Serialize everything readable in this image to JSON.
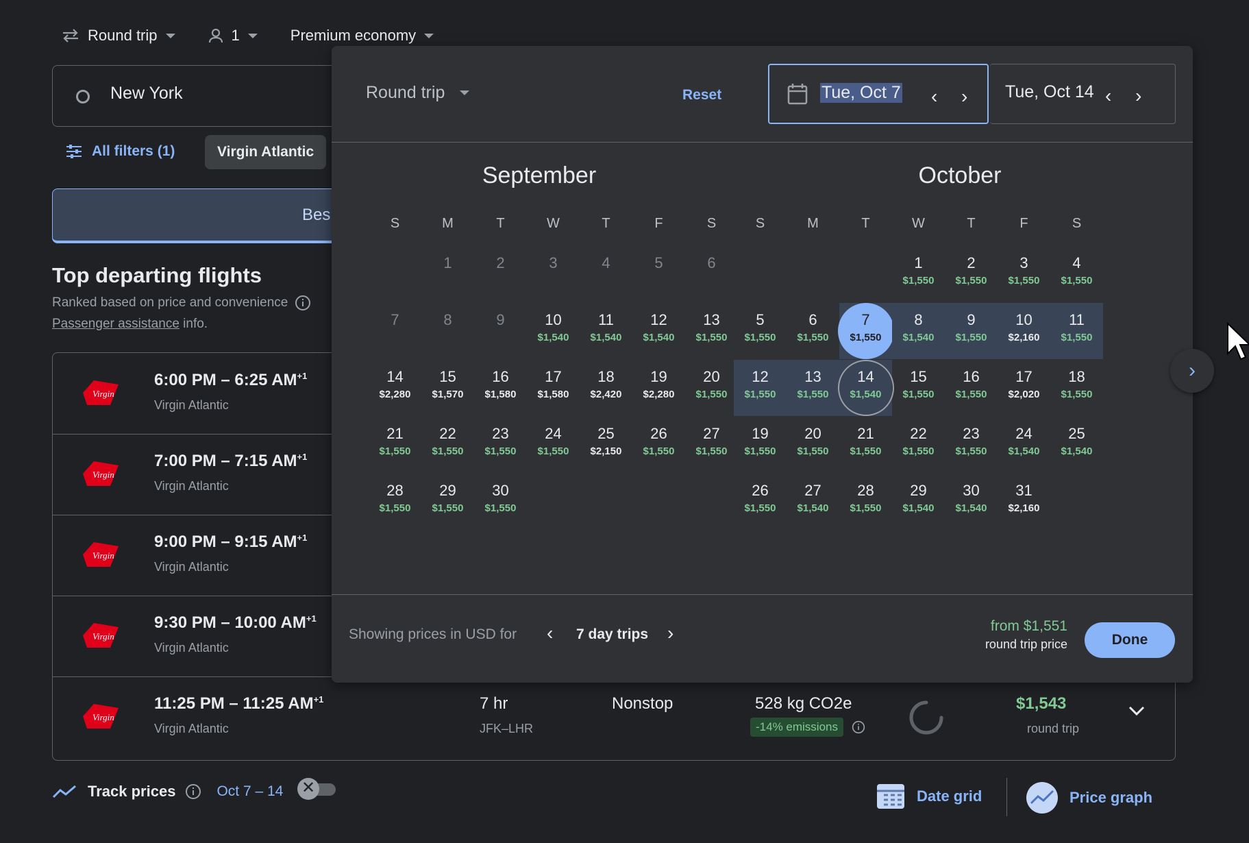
{
  "topbar": {
    "trip_type": "Round trip",
    "passengers": "1",
    "cabin": "Premium economy"
  },
  "search": {
    "origin": "New York"
  },
  "filters": {
    "all_filters": "All filters (1)",
    "chip": "Virgin Atlantic"
  },
  "tabs": {
    "best": "Bes"
  },
  "section": {
    "title": "Top departing flights",
    "subtitle": "Ranked based on price and convenience",
    "assist_link": "Passenger assistance",
    "assist_suffix": " info."
  },
  "flights": [
    {
      "time": "6:00 PM – 6:25 AM",
      "plus": "+1",
      "airline": "Virgin Atlantic"
    },
    {
      "time": "7:00 PM – 7:15 AM",
      "plus": "+1",
      "airline": "Virgin Atlantic"
    },
    {
      "time": "9:00 PM – 9:15 AM",
      "plus": "+1",
      "airline": "Virgin Atlantic"
    },
    {
      "time": "9:30 PM – 10:00 AM",
      "plus": "+1",
      "airline": "Virgin Atlantic"
    },
    {
      "time": "11:25 PM – 11:25 AM",
      "plus": "+1",
      "airline": "Virgin Atlantic",
      "duration": "7 hr",
      "route": "JFK–LHR",
      "stops": "Nonstop",
      "co2": "528 kg CO2e",
      "emissions": "-14% emissions",
      "price": "$1,543",
      "price_sub": "round trip"
    }
  ],
  "picker": {
    "trip_type": "Round trip",
    "reset": "Reset",
    "depart": "Tue, Oct 7",
    "return": "Tue, Oct 14",
    "months": [
      "September",
      "October"
    ],
    "dow": [
      "S",
      "M",
      "T",
      "W",
      "T",
      "F",
      "S"
    ],
    "september": [
      {
        "d": "1",
        "p": ""
      },
      {
        "d": "2",
        "p": ""
      },
      {
        "d": "3",
        "p": ""
      },
      {
        "d": "4",
        "p": ""
      },
      {
        "d": "5",
        "p": ""
      },
      {
        "d": "6",
        "p": ""
      },
      {
        "d": "7",
        "p": ""
      },
      {
        "d": "8",
        "p": ""
      },
      {
        "d": "9",
        "p": ""
      },
      {
        "d": "10",
        "p": "$1,540"
      },
      {
        "d": "11",
        "p": "$1,540"
      },
      {
        "d": "12",
        "p": "$1,540"
      },
      {
        "d": "13",
        "p": "$1,550"
      },
      {
        "d": "14",
        "p": "$2,280"
      },
      {
        "d": "15",
        "p": "$1,570"
      },
      {
        "d": "16",
        "p": "$1,580"
      },
      {
        "d": "17",
        "p": "$1,580"
      },
      {
        "d": "18",
        "p": "$2,420"
      },
      {
        "d": "19",
        "p": "$2,280"
      },
      {
        "d": "20",
        "p": "$1,550"
      },
      {
        "d": "21",
        "p": "$1,550"
      },
      {
        "d": "22",
        "p": "$1,550"
      },
      {
        "d": "23",
        "p": "$1,550"
      },
      {
        "d": "24",
        "p": "$1,550"
      },
      {
        "d": "25",
        "p": "$2,150"
      },
      {
        "d": "26",
        "p": "$1,550"
      },
      {
        "d": "27",
        "p": "$1,550"
      },
      {
        "d": "28",
        "p": "$1,550"
      },
      {
        "d": "29",
        "p": "$1,550"
      },
      {
        "d": "30",
        "p": "$1,550"
      }
    ],
    "october": [
      {
        "d": "1",
        "p": "$1,550"
      },
      {
        "d": "2",
        "p": "$1,550"
      },
      {
        "d": "3",
        "p": "$1,550"
      },
      {
        "d": "4",
        "p": "$1,550"
      },
      {
        "d": "5",
        "p": "$1,550"
      },
      {
        "d": "6",
        "p": "$1,550"
      },
      {
        "d": "7",
        "p": "$1,550"
      },
      {
        "d": "8",
        "p": "$1,540"
      },
      {
        "d": "9",
        "p": "$1,550"
      },
      {
        "d": "10",
        "p": "$2,160"
      },
      {
        "d": "11",
        "p": "$1,550"
      },
      {
        "d": "12",
        "p": "$1,550"
      },
      {
        "d": "13",
        "p": "$1,550"
      },
      {
        "d": "14",
        "p": "$1,540"
      },
      {
        "d": "15",
        "p": "$1,550"
      },
      {
        "d": "16",
        "p": "$1,550"
      },
      {
        "d": "17",
        "p": "$2,020"
      },
      {
        "d": "18",
        "p": "$1,550"
      },
      {
        "d": "19",
        "p": "$1,550"
      },
      {
        "d": "20",
        "p": "$1,550"
      },
      {
        "d": "21",
        "p": "$1,550"
      },
      {
        "d": "22",
        "p": "$1,550"
      },
      {
        "d": "23",
        "p": "$1,550"
      },
      {
        "d": "24",
        "p": "$1,540"
      },
      {
        "d": "25",
        "p": "$1,540"
      },
      {
        "d": "26",
        "p": "$1,550"
      },
      {
        "d": "27",
        "p": "$1,540"
      },
      {
        "d": "28",
        "p": "$1,550"
      },
      {
        "d": "29",
        "p": "$1,540"
      },
      {
        "d": "30",
        "p": "$1,540"
      },
      {
        "d": "31",
        "p": "$2,160"
      }
    ],
    "footer": {
      "showing": "Showing prices in USD for",
      "trip_len": "7 day trips",
      "from": "from $1,551",
      "from_sub": "round trip price",
      "done": "Done"
    }
  },
  "bottom": {
    "track": "Track prices",
    "range": "Oct 7 – 14",
    "date_grid": "Date grid",
    "price_graph": "Price graph"
  },
  "colors": {
    "accent": "#8ab4f8",
    "green": "#81c995",
    "brand_red": "#e1001a",
    "panel": "#303134",
    "bg": "#202124"
  }
}
